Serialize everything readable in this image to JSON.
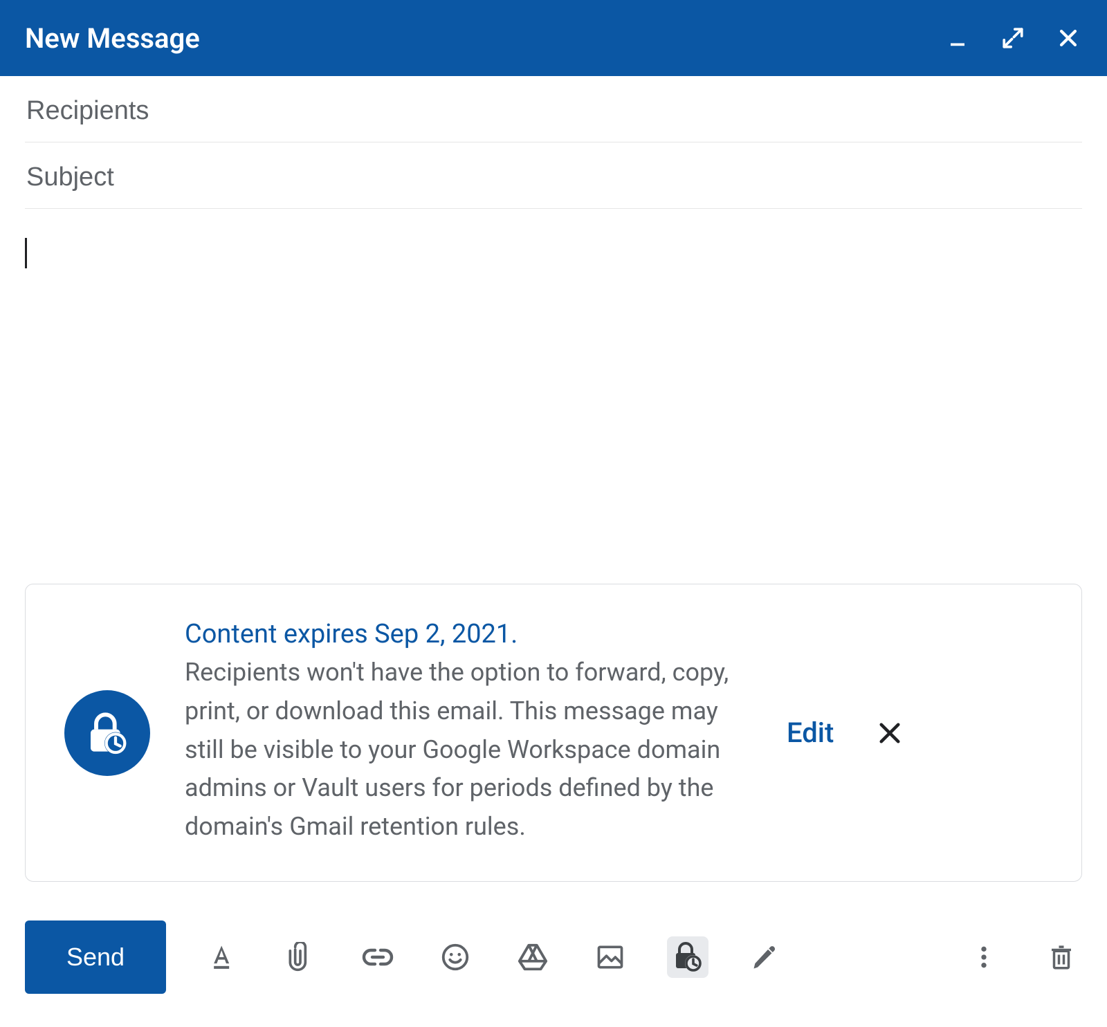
{
  "titlebar": {
    "title": "New Message"
  },
  "fields": {
    "recipients_placeholder": "Recipients",
    "recipients_value": "",
    "subject_placeholder": "Subject",
    "subject_value": ""
  },
  "body": {
    "content": ""
  },
  "confidential": {
    "headline": "Content expires Sep 2, 2021.",
    "description": "Recipients won't have the option to forward, copy, print, or download this email. This message may still be visible to your Google Workspace domain admins or Vault users for periods defined by the domain's Gmail retention rules.",
    "edit_label": "Edit"
  },
  "toolbar": {
    "send_label": "Send"
  },
  "colors": {
    "brand": "#0b57a4",
    "muted": "#5f6368"
  }
}
